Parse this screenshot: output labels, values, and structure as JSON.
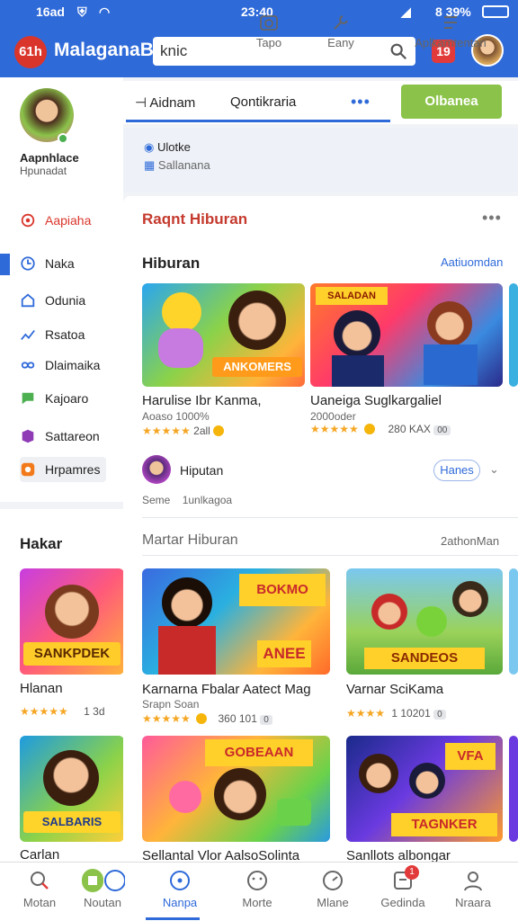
{
  "status": {
    "time_left": "16ad",
    "time_center": "23:40",
    "battery": "8 39%"
  },
  "app": {
    "name": "MalaganaB",
    "logo_text": "61h",
    "search_value": "knic",
    "red_button": "19"
  },
  "profile": {
    "name": "Aapnhlace",
    "sub": "Hpunadat"
  },
  "sidebar": {
    "items": [
      {
        "label": "Aapiaha",
        "icon": "target-icon",
        "color": "#d9352b"
      },
      {
        "label": "Naka",
        "icon": "clock-icon",
        "active": true
      },
      {
        "label": "Odunia",
        "icon": "home-icon"
      },
      {
        "label": "Rsatoa",
        "icon": "chart-icon"
      },
      {
        "label": "Dlaimaika",
        "icon": "infinity-icon"
      },
      {
        "label": "Kajoaro",
        "icon": "chat-icon",
        "color": "#4caf50"
      },
      {
        "label": "Sattareon",
        "icon": "tag-icon",
        "color": "#8e3bb5"
      },
      {
        "label": "Hrpamres",
        "icon": "orange-square-icon",
        "color": "#f27a1a"
      }
    ]
  },
  "tabs": {
    "tab1": "Aidnam",
    "tab2": "ontikraria",
    "more": "•••",
    "button": "Olbanea"
  },
  "quick": [
    {
      "label1": "Ulotke",
      "label2": "Sallanana"
    },
    {
      "label": "Tapo"
    },
    {
      "label": "Eany"
    },
    {
      "label": "Aplkamtentan"
    }
  ],
  "card": {
    "header": "Raqnt Hiburan",
    "section1": {
      "title": "Hiburan",
      "link": "Aatiuomdan"
    },
    "games1": [
      {
        "title": "Harulise Ibr Kanma,",
        "sub": "Aoaso 1000%",
        "rating": "★★★★★",
        "extra": "2all"
      },
      {
        "title": "Uaneiga Suglkargaliel",
        "sub": "2000oder",
        "rating": "★★★★★",
        "extra": "280 KAX",
        "tag": "00"
      }
    ],
    "creator": {
      "name": "Hiputan",
      "follow": "Hanes",
      "meta1": "Seme",
      "meta2": "1unlkagoa"
    },
    "section2": {
      "title": "Martar Hiburan",
      "link": "2athonMan"
    },
    "games2": [
      {
        "title": "Karnarna Fbalar Aatect Mag",
        "sub": "Srapn Soan",
        "rating": "★★★★★",
        "extra": "360 101",
        "tag": "0"
      },
      {
        "title": "Varnar SciKama",
        "rating": "★★★★",
        "extra": "1 10201",
        "tag": "0"
      }
    ],
    "games3": [
      {
        "title": "Sellantal Vlor AalsoSolinta"
      },
      {
        "title": "Sanllots albongar"
      }
    ]
  },
  "left_lower": {
    "title": "Hakar",
    "g1": {
      "title": "Hlanan",
      "rating": "★★★★★",
      "extra": "1 3d"
    },
    "g2": {
      "title": "Carlan"
    }
  },
  "bottom_nav": [
    {
      "label": "Motan"
    },
    {
      "label": "Noutan"
    },
    {
      "label": "Nanpa",
      "active": true
    },
    {
      "label": "Morte"
    },
    {
      "label": "Mlane"
    },
    {
      "label": "Gedinda",
      "badge": "1"
    },
    {
      "label": "Nraara"
    }
  ],
  "colors": {
    "primary": "#2f6ad9",
    "green": "#8bc34a",
    "red": "#e23a3a",
    "star": "#f5a623"
  }
}
